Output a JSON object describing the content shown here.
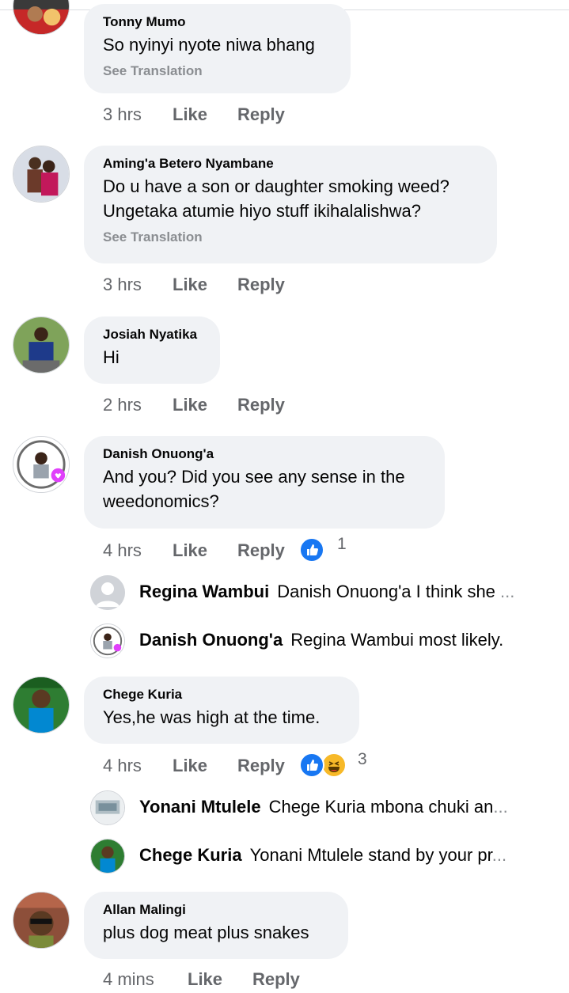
{
  "comments": [
    {
      "author": "Tonny Mumo",
      "lines": [
        "So nyinyi nyote niwa bhang"
      ],
      "see_translation": "See Translation",
      "time": "3 hrs",
      "like": "Like",
      "reply": "Reply"
    },
    {
      "author": "Aming'a Betero Nyambane",
      "lines": [
        "Do u have a son or daughter smoking weed?",
        "Ungetaka atumie hiyo stuff ikihalalishwa?"
      ],
      "see_translation": "See Translation",
      "time": "3 hrs",
      "like": "Like",
      "reply": "Reply"
    },
    {
      "author": "Josiah Nyatika",
      "lines": [
        "Hi"
      ],
      "time": "2 hrs",
      "like": "Like",
      "reply": "Reply"
    },
    {
      "author": "Danish Onuong'a",
      "lines": [
        "And you? Did you see any sense in the",
        "weedonomics?"
      ],
      "time": "4 hrs",
      "like": "Like",
      "reply": "Reply",
      "reactions": {
        "icons": [
          "like-icon"
        ],
        "count": "1"
      },
      "replies": [
        {
          "author": "Regina Wambui",
          "text": "Danish Onuong'a I think she",
          "ellipsis": "..."
        },
        {
          "author": "Danish Onuong'a",
          "text": "Regina Wambui most likely.",
          "ellipsis": ""
        }
      ]
    },
    {
      "author": "Chege Kuria",
      "lines": [
        "Yes,he was high at the time."
      ],
      "time": "4 hrs",
      "like": "Like",
      "reply": "Reply",
      "reactions": {
        "icons": [
          "like-icon",
          "haha-icon"
        ],
        "count": "3"
      },
      "replies": [
        {
          "author": "Yonani Mtulele",
          "text": "Chege Kuria mbona chuki an",
          "ellipsis": "..."
        },
        {
          "author": "Chege Kuria",
          "text": "Yonani Mtulele stand by your pr",
          "ellipsis": "..."
        }
      ]
    },
    {
      "author": "Allan Malingi",
      "lines": [
        "plus dog meat plus snakes"
      ],
      "time": "4 mins",
      "like": "Like",
      "reply": "Reply"
    }
  ],
  "colors": {
    "bubble": "#f0f2f5",
    "meta_text": "#65676b",
    "like_blue": "#1877f2",
    "haha_yellow": "#f7b928"
  }
}
